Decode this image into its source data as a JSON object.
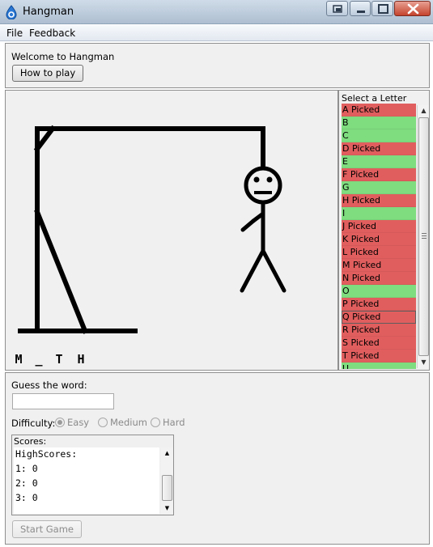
{
  "window": {
    "title": "Hangman"
  },
  "menu": {
    "file": "File",
    "feedback": "Feedback"
  },
  "top_panel": {
    "welcome": "Welcome to Hangman",
    "how_to_play": "How to play"
  },
  "word": {
    "letters": [
      "M",
      "_",
      "T",
      "H"
    ]
  },
  "letters_panel": {
    "header": "Select a Letter",
    "items": [
      {
        "label": "A Picked",
        "status": "picked"
      },
      {
        "label": "B",
        "status": "available"
      },
      {
        "label": "C",
        "status": "available"
      },
      {
        "label": "D Picked",
        "status": "picked"
      },
      {
        "label": "E",
        "status": "available"
      },
      {
        "label": "F Picked",
        "status": "picked"
      },
      {
        "label": "G",
        "status": "available"
      },
      {
        "label": "H Picked",
        "status": "picked"
      },
      {
        "label": "I",
        "status": "available"
      },
      {
        "label": "J Picked",
        "status": "picked"
      },
      {
        "label": "K Picked",
        "status": "picked"
      },
      {
        "label": "L Picked",
        "status": "picked"
      },
      {
        "label": "M Picked",
        "status": "picked"
      },
      {
        "label": "N Picked",
        "status": "picked"
      },
      {
        "label": "O",
        "status": "available"
      },
      {
        "label": "P Picked",
        "status": "picked"
      },
      {
        "label": "Q Picked",
        "status": "picked",
        "focused": true
      },
      {
        "label": "R Picked",
        "status": "picked"
      },
      {
        "label": "S Picked",
        "status": "picked"
      },
      {
        "label": "T Picked",
        "status": "picked"
      },
      {
        "label": "U",
        "status": "available"
      }
    ]
  },
  "colors": {
    "picked": "#e15e5e",
    "available": "#7fdc7f"
  },
  "bottom_panel": {
    "guess_label": "Guess the word:",
    "guess_value": "",
    "difficulty_label": "Difficulty:",
    "difficulty_options": [
      "Easy",
      "Medium",
      "Hard"
    ],
    "difficulty_selected": "Easy",
    "scores_label": "Scores:",
    "scores_lines": [
      "HighScores:",
      "1: 0",
      "2: 0",
      "3: 0"
    ],
    "start_game": "Start Game"
  }
}
